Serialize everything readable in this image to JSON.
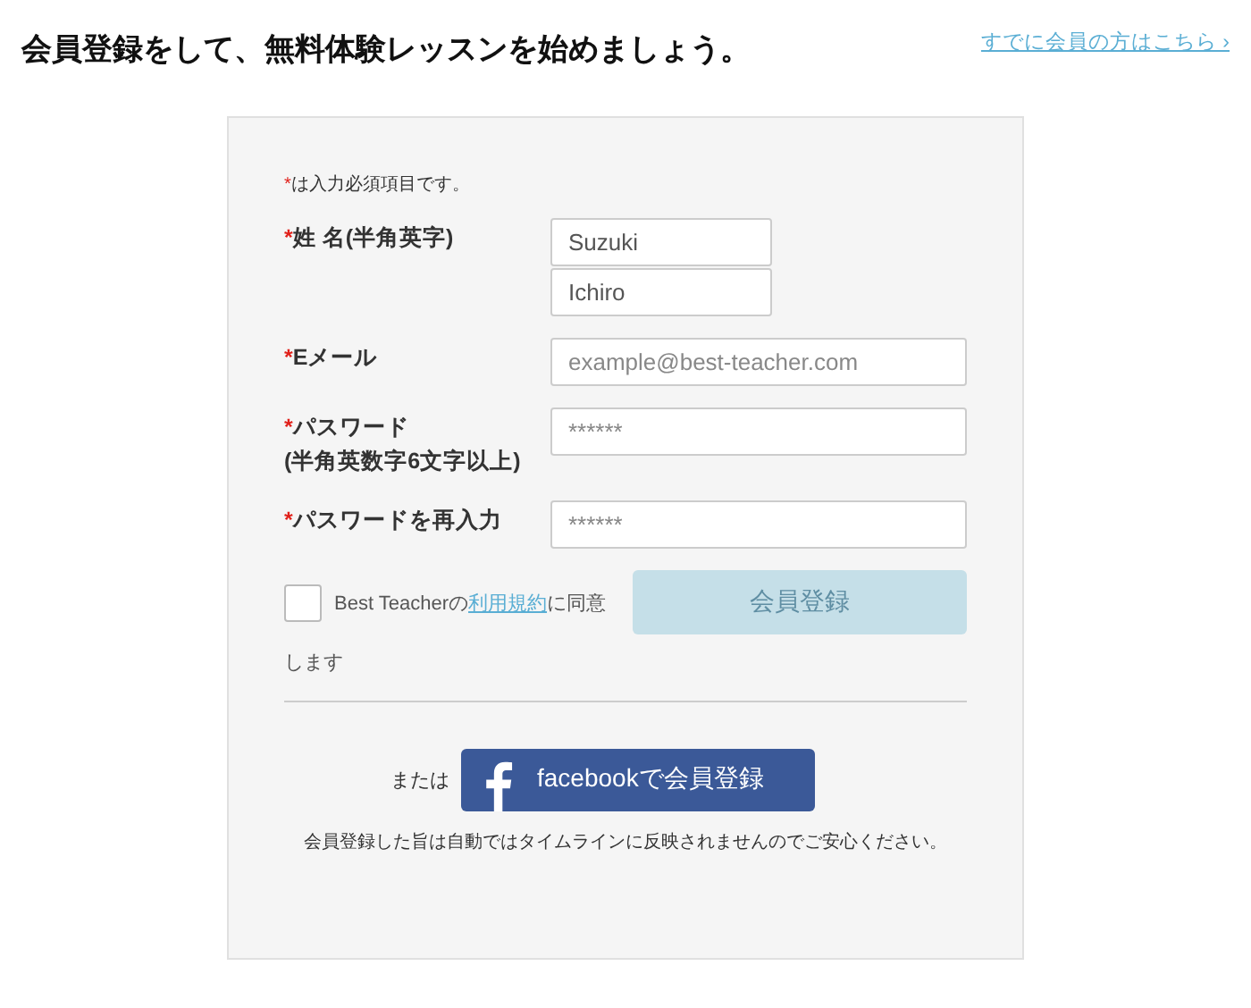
{
  "header": {
    "title": "会員登録をして、無料体験レッスンを始めましょう。",
    "login_link": "すでに会員の方はこちら ›"
  },
  "form": {
    "required_note": {
      "mark": "*",
      "text": "は入力必須項目です。"
    },
    "fields": [
      {
        "kind": "name",
        "mark": "*",
        "label": "姓 名(半角英字)",
        "inputs": [
          {
            "value": "Suzuki"
          },
          {
            "value": "Ichiro"
          }
        ]
      },
      {
        "kind": "text",
        "mark": "*",
        "label": "Eメール",
        "inputs": [
          {
            "placeholder": "example@best-teacher.com"
          }
        ]
      },
      {
        "kind": "text",
        "mark": "*",
        "label": "パスワード",
        "sublabel": "(半角英数字6文字以上)",
        "inputs": [
          {
            "placeholder": "******"
          }
        ]
      },
      {
        "kind": "text",
        "mark": "*",
        "label": "パスワードを再入力",
        "inputs": [
          {
            "placeholder": "******"
          }
        ]
      }
    ],
    "agreement": {
      "checked": false,
      "before": "Best Teacherの",
      "link": "利用規約",
      "after": "に同意",
      "continuation": "します"
    },
    "submit": {
      "label": "会員登録",
      "disabled": true
    },
    "facebook": {
      "or": "または",
      "label": "facebookで会員登録"
    },
    "note": "会員登録した旨は自動ではタイムラインに反映されませんのでご安心ください。"
  }
}
